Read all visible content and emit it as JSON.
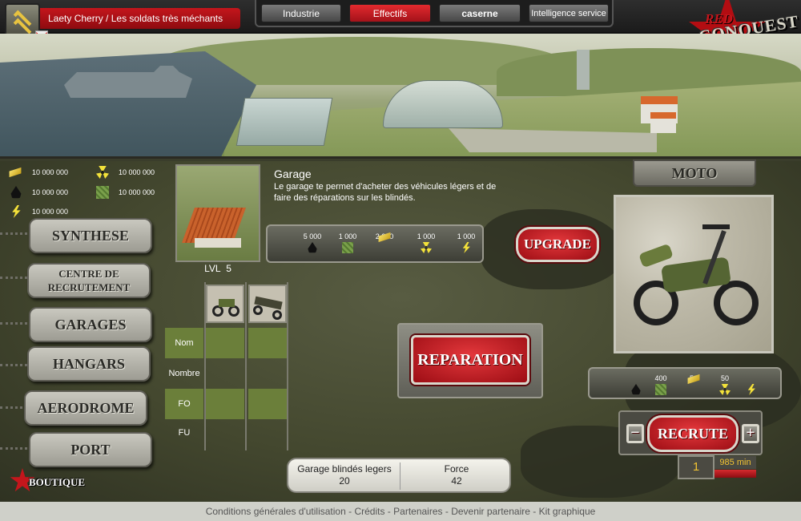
{
  "header": {
    "player_name": "Laety Cherry",
    "separator": "/",
    "unit_name": "Les soldats très méchants",
    "nav": [
      "Industrie",
      "Effectifs",
      "caserne",
      "Intelligence service"
    ],
    "logo_top": "RED",
    "logo_bottom": "CONQUEST",
    "active_tab": "Effectifs",
    "accent_color": "#c4161c"
  },
  "resources": {
    "gold": "10 000 000",
    "uranium": "10 000 000",
    "oil": "10 000 000",
    "steel": "10 000 000",
    "energy": "10 000 000"
  },
  "menu": [
    "SYNTHESE",
    "CENTRE DE RECRUTEMENT",
    "GARAGES",
    "HANGARS",
    "AERODROME",
    "PORT"
  ],
  "shop": "BOUTIQUE",
  "building": {
    "name": "Garage",
    "description": "Le garage te permet d'acheter des véhicules légers et de faire des réparations sur les blindés.",
    "level_label": "LVL",
    "level": "5",
    "upgrade_costs": [
      "5 000",
      "1 000",
      "2 000",
      "1 000",
      "1 000"
    ],
    "upgrade_icons": [
      "oil-icon",
      "steel-icon",
      "gold-icon",
      "uranium-icon",
      "energy-icon"
    ],
    "upgrade_label": "UPGRADE",
    "repair_label": "REPARATION"
  },
  "vehicle_table": {
    "rows": [
      "Nom",
      "Nombre",
      "FO",
      "FU"
    ],
    "thumbnails": [
      "motorcycle-thumb",
      "buggy-thumb"
    ]
  },
  "stats": {
    "garage_label": "Garage blindés legers",
    "garage_value": "20",
    "force_label": "Force",
    "force_value": "42"
  },
  "unit": {
    "name": "MOTO",
    "costs": [
      "",
      "400",
      "50",
      "50",
      ""
    ],
    "cost_icons": [
      "oil-icon",
      "steel-icon",
      "gold-icon",
      "uranium-icon",
      "energy-icon"
    ],
    "recruit_label": "RECRUTE",
    "minus": "−",
    "plus": "+",
    "quantity": "1",
    "time": "985 min"
  },
  "footer": [
    "Conditions générales d'utilisation",
    "Crédits",
    "Partenaires",
    "Devenir partenaire",
    "Kit graphique"
  ]
}
